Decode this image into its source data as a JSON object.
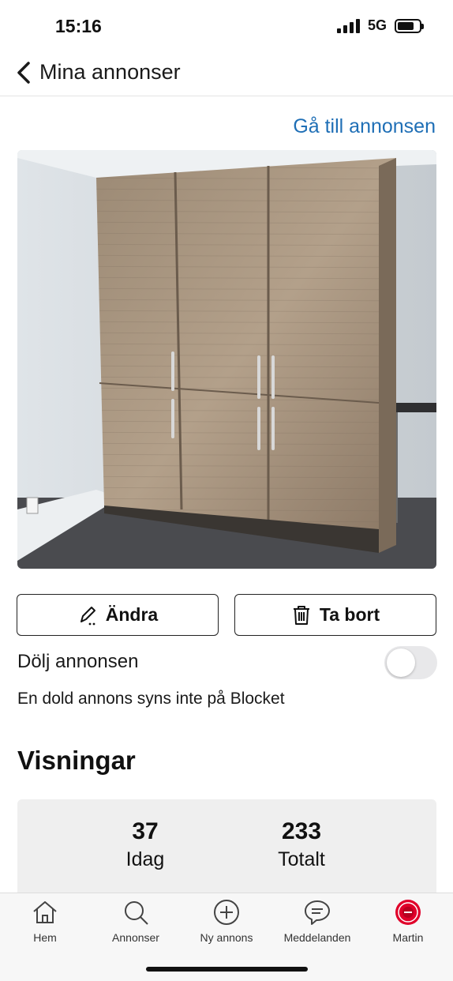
{
  "status_bar": {
    "time": "15:16",
    "network": "5G",
    "battery_level": 0.75
  },
  "header": {
    "title": "Mina annonser",
    "back_icon": "chevron-left-icon"
  },
  "goto_link": "Gå till annonsen",
  "listing": {
    "image_icon": "wardrobe-photo",
    "edit_label": "Ändra",
    "edit_icon": "pencil-icon",
    "delete_label": "Ta bort",
    "delete_icon": "trash-icon"
  },
  "visibility": {
    "label": "Dölj annonsen",
    "enabled": false,
    "description": "En dold annons syns inte på Blocket"
  },
  "views": {
    "title": "Visningar",
    "today_value": "37",
    "today_label": "Idag",
    "total_value": "233",
    "total_label": "Totalt"
  },
  "tabbar": {
    "items": [
      {
        "label": "Hem",
        "icon": "home-icon"
      },
      {
        "label": "Annonser",
        "icon": "search-icon"
      },
      {
        "label": "Ny annons",
        "icon": "plus-circle-icon"
      },
      {
        "label": "Meddelanden",
        "icon": "chat-bubble-icon"
      },
      {
        "label": "Martin",
        "icon": "avatar-icon"
      }
    ],
    "accent_color": "#e0002a"
  },
  "colors": {
    "link": "#1f6fb6",
    "stats_bg": "#efefef"
  }
}
